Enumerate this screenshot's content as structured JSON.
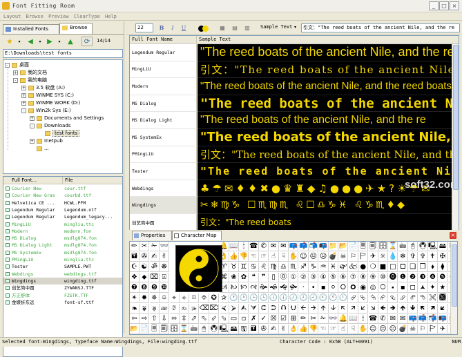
{
  "app": {
    "title": "Font Fitting Room"
  },
  "menu": [
    "Layout",
    "Browse",
    "Preview",
    "ClearType",
    "Help"
  ],
  "left": {
    "tabs": [
      "Installed Fonts",
      "Browse"
    ],
    "page_counter": "14/14",
    "path": "E:\\Downloads\\test fonts",
    "tree": [
      {
        "label": "桌面",
        "indent": 0,
        "pm": "-"
      },
      {
        "label": "我的文档",
        "indent": 1,
        "pm": "+"
      },
      {
        "label": "我的电脑",
        "indent": 1,
        "pm": "-"
      },
      {
        "label": "3.5 软盘 (A:)",
        "indent": 2,
        "pm": "+"
      },
      {
        "label": "WINME SYS (C:)",
        "indent": 2,
        "pm": "+"
      },
      {
        "label": "WINME WORK (D:)",
        "indent": 2,
        "pm": "+"
      },
      {
        "label": "Win2k Sys (E:)",
        "indent": 2,
        "pm": "-"
      },
      {
        "label": "Documents and Settings",
        "indent": 3,
        "pm": "+"
      },
      {
        "label": "Downloads",
        "indent": 3,
        "pm": "-"
      },
      {
        "label": "test fonts",
        "indent": 4,
        "pm": "",
        "selected": true
      },
      {
        "label": "Inetpub",
        "indent": 3,
        "pm": "+"
      },
      {
        "label": "...",
        "indent": 3,
        "pm": ""
      }
    ],
    "list_headers": [
      "Full Font...",
      "File"
    ],
    "files": [
      {
        "name": "Courier New",
        "file": "cour.ttf",
        "green": true
      },
      {
        "name": "Courier New Gras",
        "file": "courbd.ttf",
        "green": true
      },
      {
        "name": "Helvetica CE ...",
        "file": "HCWL.PFM",
        "green": false
      },
      {
        "name": "Legendum Regular",
        "file": "Legendum.otf",
        "green": false
      },
      {
        "name": "Legendum Regular",
        "file": "Legendum_legacy...",
        "green": false
      },
      {
        "name": "MingLiU",
        "file": "mingliu.ttc",
        "green": true
      },
      {
        "name": "Modern",
        "file": "modern.fon",
        "green": true
      },
      {
        "name": "MS Dialog",
        "file": "msdlg874.fon",
        "green": true
      },
      {
        "name": "MS Dialog Light",
        "file": "msdlg874.fon",
        "green": true
      },
      {
        "name": "MS SystemEx",
        "file": "msdlg874.fon",
        "green": true
      },
      {
        "name": "PMingLiU",
        "file": "mingliu.ttc",
        "green": true
      },
      {
        "name": "Tester",
        "file": "SAMPLE.PWT",
        "green": false
      },
      {
        "name": "Webdings",
        "file": "webdings.ttf",
        "green": true
      },
      {
        "name": "Wingdings",
        "file": "wingding.ttf",
        "green": false,
        "selected": true
      },
      {
        "name": "创艺简中圆",
        "file": "ZYWANSJ.TTF",
        "green": false
      },
      {
        "name": "方正舒体",
        "file": "FZSTK.TTF",
        "green": true
      },
      {
        "name": "金蝶折东远",
        "file": "font-sf.ttf",
        "green": false
      }
    ]
  },
  "toolbar": {
    "size": "22",
    "bold": "B",
    "italic": "I",
    "underline": "U",
    "mode": "Sample Text",
    "sample_text": "引文：\"The reed boats of the ancient Nile, and the re"
  },
  "grid": {
    "headers": [
      "Full Font Name",
      "Sample Text"
    ],
    "rows": [
      {
        "name": "Legendum Regular",
        "sample": "\"The reed boats of the ancient Nile, and the re",
        "style": "s1"
      },
      {
        "name": "MingLiU",
        "sample": "引文：\"The reed boats of the ancient Nile, and",
        "style": "s2"
      },
      {
        "name": "Modern",
        "sample": "\"The reed boats of the ancient Nile, and the reed boats",
        "style": "s3"
      },
      {
        "name": "MS Dialog",
        "sample": "\"The reed boats of the ancient Nile",
        "style": "s4"
      },
      {
        "name": "MS Dialog Light",
        "sample": "\"The reed boats of the ancient Nile, and the re",
        "style": "s5"
      },
      {
        "name": "MS SystemEx",
        "sample": "\"The reed boats of the ancient Nile, a",
        "style": "s6"
      },
      {
        "name": "PMingLiU",
        "sample": "引文：\"The reed boats of the ancient Nile, and the r",
        "style": "s7"
      },
      {
        "name": "Tester",
        "sample": "\"The reed boats of the ancient Nile,",
        "style": "s8"
      },
      {
        "name": "Webdings",
        "sample": "♣☂✉♦♦✖●♛♜◆♫●●●✈★?☀☂✉",
        "style": "s9"
      },
      {
        "name": "Wingdings",
        "sample": "✂❄♍♑ ☐♏♍♏ ♌☐♎♑♓ ♌♑♏♦◆",
        "style": "s10",
        "selected": true
      },
      {
        "name": "创艺简中圆",
        "sample": "引文：\"The reed boats",
        "style": "s11"
      }
    ]
  },
  "watermark": "soft32.com",
  "bottom_tabs": [
    "Properties",
    "Character Map"
  ],
  "charmap": {
    "glyphs": "✏✂✁👓🔔📖🕯☎✆✉✉📪📫📬📭📁📂📄🗏🗐🗄⌛🖮🖰🖲🖳🖴🖫🖬✇✍✌👌👍👎☜☞☝☟✋☺😐☹💣☠⚐🏱✈☼💧❄✞✞✝✠✡☪☯ॐ☸♈♉♊♋♌♍♎♏♐♑♒♓🙰🙵●❍■□🞐❑❒⬧⧫◆❖⬥⌧⍓⌘❀✿❝❞▯⓪①②③④⑤⑥⑦⑧⑨⑩⓿❶❷❸❹❺❻❼❽❾❿🙢🙠🙡🙣🙞🙜🙝🙟·•▪⚪🞆🞈◉◎🞅🞍▪◻🟂✦★✶✴✹✵⯐⌖⟡⌑⯑✪✰🕐🕑🕒🕓🕔🕕🕖🕗🕘🕙🕚🕛⮰⮱⮲⮳⮴⮵⮶⮷🙪🙫🙕🙔🙗🙖🙐🙑🙒🙓⌫⌦⮘⮚⮙⮛⮈⮊⮉⮋🡨🡪🡩🡫🡬🡭🡯🡮🡸🡺🡹🡻🡼🡽🡿🡾⇦⇨⇧⇩⬄⇳⬀⬁⬃⬂▭▫✗✓☒☑⊞",
    "lead_glyphs": [
      "✏",
      "✂",
      "🖫",
      "🖬",
      "✇",
      "✍",
      "✞",
      "✞",
      "✝",
      "✠",
      "♏",
      "♐",
      "❑",
      "❒",
      "⬧",
      "⧫",
      "❾",
      "❿",
      "❹",
      "❺",
      "🕐",
      "🕑",
      "⮰",
      "⮱"
    ]
  },
  "status": {
    "left": "Selected font:Wingdings, Typeface Name:Wingdings, File:wingding.ttf",
    "char": "Character Code : 0x5B (ALT+0091)",
    "num": "NUM"
  },
  "colors": {
    "sample_bg": "#000000",
    "sample_fg": "#f5d800",
    "accent": "#316ac5"
  }
}
